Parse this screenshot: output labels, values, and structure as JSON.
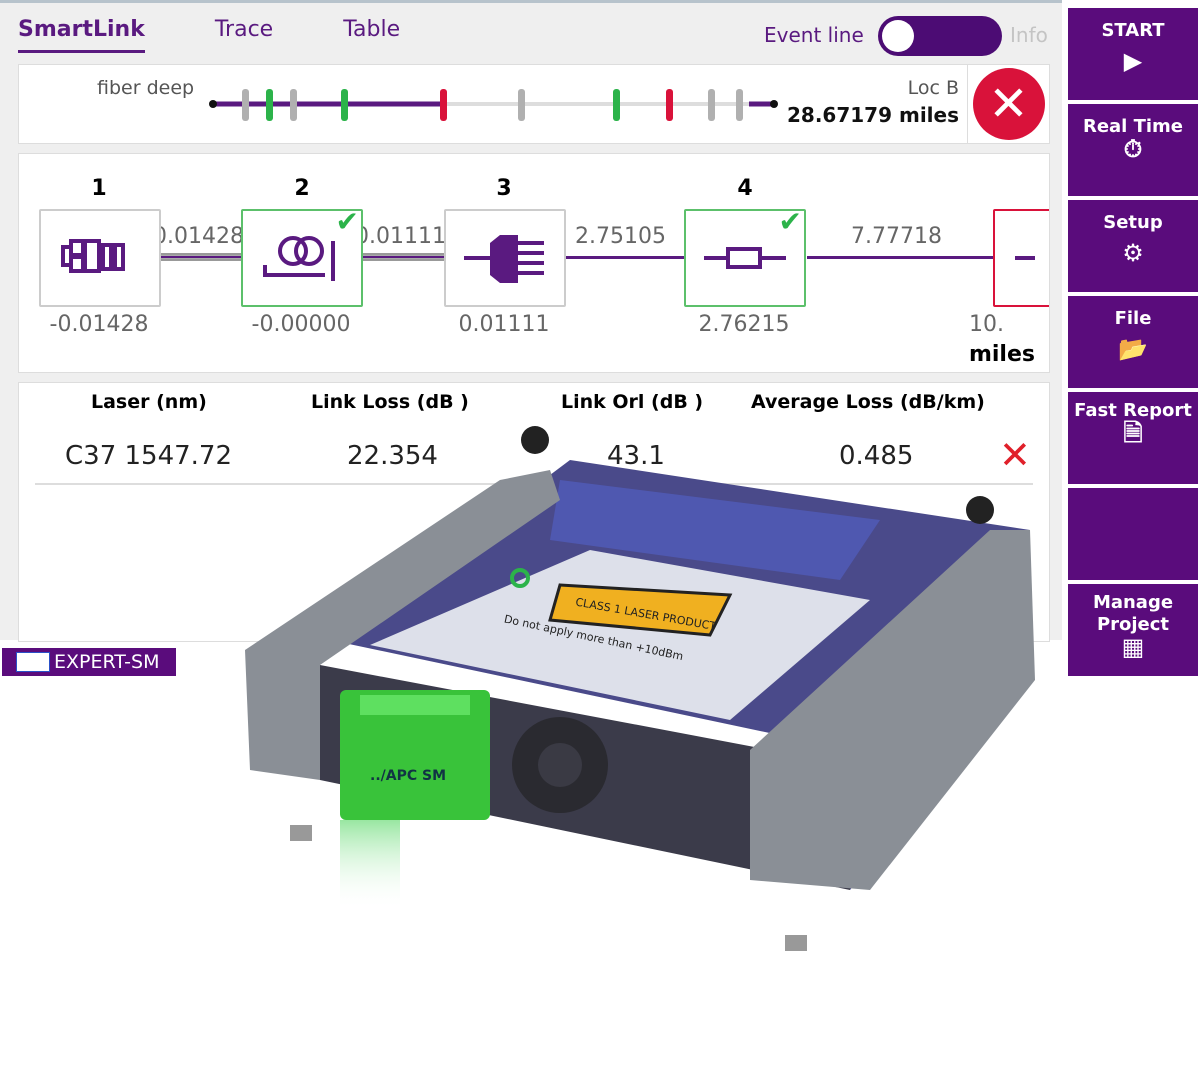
{
  "tabs": [
    {
      "label": "SmartLink",
      "active": true
    },
    {
      "label": "Trace"
    },
    {
      "label": "Table"
    }
  ],
  "toggle": {
    "label": "Event line",
    "state": "on",
    "info_label": "Info"
  },
  "link_bar": {
    "name": "fiber deep",
    "end_label": "Loc B",
    "distance": "28.67179 miles",
    "status": "fail",
    "markers": [
      "gray",
      "green",
      "gray",
      "green",
      "red",
      "gray",
      "green",
      "red",
      "gray",
      "gray"
    ]
  },
  "diagram": {
    "events": [
      {
        "index": "1",
        "position": "-0.01428",
        "status": "none",
        "icon": "launch-connector-icon"
      },
      {
        "index": "2",
        "position": "-0.00000",
        "status": "pass",
        "icon": "fiber-spool-icon"
      },
      {
        "index": "3",
        "position": "0.01111",
        "status": "none",
        "icon": "connector-icon"
      },
      {
        "index": "4",
        "position": "2.76215",
        "status": "pass",
        "icon": "splice-icon"
      },
      {
        "index": "",
        "position": "10.",
        "status": "fail",
        "icon": "event-icon"
      }
    ],
    "segments": [
      "0.01428",
      "0.01111",
      "2.75105",
      "7.77718"
    ],
    "unit": "miles"
  },
  "results": {
    "headers": [
      "Laser (nm)",
      "Link Loss (dB )",
      "Link Orl (dB )",
      "Average Loss (dB/km)"
    ],
    "row": [
      "C37 1547.72",
      "22.354",
      "43.1",
      "0.485"
    ],
    "status": "fail"
  },
  "sidebar": [
    {
      "label": "START",
      "icon": "play-icon"
    },
    {
      "label": "Real Time",
      "icon": "stopwatch-icon"
    },
    {
      "label": "Setup",
      "icon": "gear-icon"
    },
    {
      "label": "File",
      "icon": "folder-icon"
    },
    {
      "label": "Fast Report",
      "icon": "report-icon"
    },
    {
      "label": "",
      "icon": ""
    },
    {
      "label": "Manage Project",
      "icon": "grid-icon"
    }
  ],
  "module_badge": "EXPERT-SM",
  "device": {
    "laser_label": "CLASS 1 LASER PRODUCT",
    "warning": "Do not apply more than +10dBm",
    "port_label": "../APC SM"
  },
  "colors": {
    "brand": "#5a0c7c",
    "pass": "#2cb34a",
    "fail": "#d9123a"
  }
}
